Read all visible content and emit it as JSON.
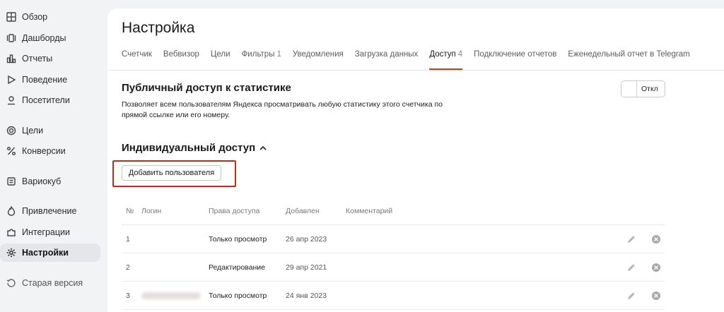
{
  "sidebar": {
    "items": [
      {
        "label": "Обзор",
        "icon": "grid-icon"
      },
      {
        "label": "Дашборды",
        "icon": "dashboards-icon"
      },
      {
        "label": "Отчеты",
        "icon": "bar-chart-icon"
      },
      {
        "label": "Поведение",
        "icon": "play-icon"
      },
      {
        "label": "Посетители",
        "icon": "user-icon"
      },
      {
        "label": "Цели",
        "icon": "target-icon"
      },
      {
        "label": "Конверсии",
        "icon": "percent-icon"
      },
      {
        "label": "Вариокуб",
        "icon": "cube-icon"
      },
      {
        "label": "Привлечение",
        "icon": "flame-icon"
      },
      {
        "label": "Интеграции",
        "icon": "puzzle-icon"
      },
      {
        "label": "Настройки",
        "icon": "gear-icon"
      },
      {
        "label": "Старая версия",
        "icon": "history-icon"
      }
    ]
  },
  "page": {
    "title": "Настройка"
  },
  "tabs": [
    {
      "label": "Счетчик",
      "count": ""
    },
    {
      "label": "Вебвизор",
      "count": ""
    },
    {
      "label": "Цели",
      "count": ""
    },
    {
      "label": "Фильтры",
      "count": "1"
    },
    {
      "label": "Уведомления",
      "count": ""
    },
    {
      "label": "Загрузка данных",
      "count": ""
    },
    {
      "label": "Доступ",
      "count": "4"
    },
    {
      "label": "Подключение отчетов",
      "count": ""
    },
    {
      "label": "Еженедельный отчет в Telegram",
      "count": ""
    }
  ],
  "public_access": {
    "title": "Публичный доступ к статистике",
    "description": "Позволяет всем пользователям Яндекса просматривать любую статистику этого счетчика по прямой ссылке или его номеру.",
    "toggle_label": "Откл"
  },
  "individual_access": {
    "title": "Индивидуальный доступ",
    "add_button": "Добавить пользователя"
  },
  "table": {
    "headers": {
      "num": "№",
      "login": "Логин",
      "rights": "Права доступа",
      "added": "Добавлен",
      "comment": "Комментарий"
    },
    "rows": [
      {
        "num": "1",
        "login": "",
        "rights": "Только просмотр",
        "added": "26 апр 2023",
        "comment": ""
      },
      {
        "num": "2",
        "login": "",
        "rights": "Редактирование",
        "added": "29 апр 2021",
        "comment": ""
      },
      {
        "num": "3",
        "login": "",
        "rights": "Только просмотр",
        "added": "24 янв 2023",
        "comment": ""
      }
    ]
  },
  "colors": {
    "accent": "#e0311b",
    "highlight": "#c9261d",
    "background": "#f2f3f5"
  }
}
